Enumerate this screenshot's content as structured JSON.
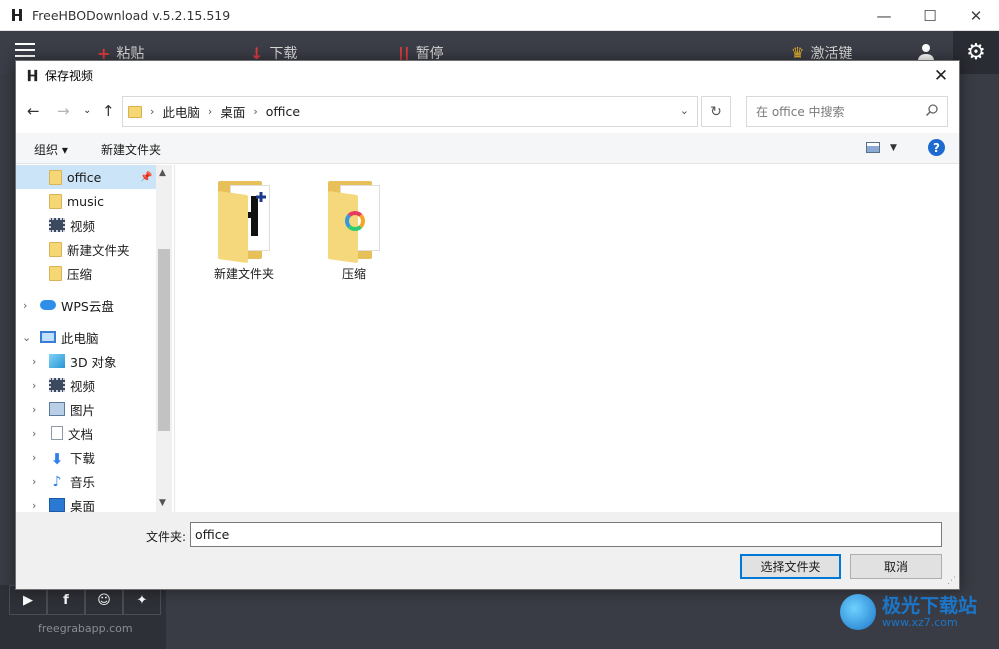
{
  "app": {
    "title": "FreeHBODownload   v.5.2.15.519",
    "toolbar": {
      "paste_icon": "+",
      "paste": "粘贴",
      "download_icon": "↓",
      "download": "下载",
      "pause_icon": "||",
      "pause": "暂停",
      "activate_icon": "crown-icon",
      "activate": "激活键"
    },
    "social": [
      "youtube-icon",
      "facebook-icon",
      "reddit-icon",
      "twitter-icon"
    ],
    "site": "freegrabapp.com"
  },
  "dialog": {
    "title": "保存视频",
    "breadcrumb": [
      "此电脑",
      "桌面",
      "office"
    ],
    "search_placeholder": "在 office 中搜索",
    "cmd": {
      "organize": "组织 ▾",
      "new_folder": "新建文件夹"
    },
    "nav": {
      "quick": [
        {
          "label": "office",
          "selected": true,
          "pinned": true
        },
        {
          "label": "music"
        },
        {
          "label": "视频"
        },
        {
          "label": "新建文件夹"
        },
        {
          "label": "压缩"
        }
      ],
      "wps": "WPS云盘",
      "this_pc": "此电脑",
      "pc_items": [
        "3D 对象",
        "视频",
        "图片",
        "文档",
        "下载",
        "音乐",
        "桌面"
      ]
    },
    "files": [
      {
        "name": "新建文件夹"
      },
      {
        "name": "压缩"
      }
    ],
    "folder_label": "文件夹:",
    "folder_value": "office",
    "buttons": {
      "select": "选择文件夹",
      "cancel": "取消"
    }
  },
  "watermark": {
    "name": "极光下载站",
    "url": "www.xz7.com"
  },
  "colors": {
    "accent": "#0078d7",
    "app_bg": "#3a3c45",
    "selected": "#cce4f7"
  }
}
